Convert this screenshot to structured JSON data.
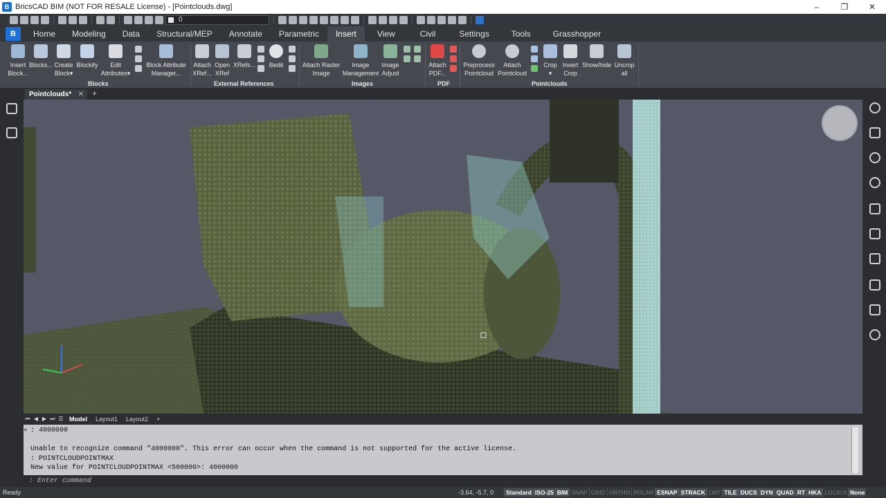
{
  "window": {
    "title": "BricsCAD BIM (NOT FOR RESALE License) - [Pointclouds.dwg]",
    "controls": [
      "–",
      "❐",
      "✕"
    ]
  },
  "qat": {
    "layer_value": "0"
  },
  "ribbon_tabs": [
    "Home",
    "Modeling",
    "Data",
    "Structural/MEP",
    "Annotate",
    "Parametric",
    "Insert",
    "View",
    "Civil",
    "Settings",
    "Tools",
    "Grasshopper"
  ],
  "active_tab": "Insert",
  "ribbon": {
    "blocks": {
      "label": "Blocks",
      "buttons": [
        {
          "l1": "Insert",
          "l2": "Block..."
        },
        {
          "l1": "Blocks...",
          "l2": ""
        },
        {
          "l1": "Create",
          "l2": "Block▾"
        },
        {
          "l1": "Blockify",
          "l2": ""
        },
        {
          "l1": "Edit",
          "l2": "Attributes▾"
        },
        {
          "l1": "Block Attribute",
          "l2": "Manager..."
        }
      ]
    },
    "xref": {
      "label": "External References",
      "buttons": [
        {
          "l1": "Attach",
          "l2": "XRef..."
        },
        {
          "l1": "Open",
          "l2": "XRef"
        },
        {
          "l1": "XRefs...",
          "l2": ""
        },
        {
          "l1": "Bedit",
          "l2": ""
        }
      ]
    },
    "images": {
      "label": "Images",
      "buttons": [
        {
          "l1": "Attach Raster",
          "l2": "Image"
        },
        {
          "l1": "Image",
          "l2": "Management"
        },
        {
          "l1": "Image",
          "l2": "Adjust"
        }
      ]
    },
    "pdf": {
      "label": "PDF",
      "buttons": [
        {
          "l1": "Attach",
          "l2": "PDF..."
        }
      ]
    },
    "pointclouds": {
      "label": "Pointclouds",
      "buttons": [
        {
          "l1": "Preprocess",
          "l2": "Pointcloud"
        },
        {
          "l1": "Attach",
          "l2": "Pointcloud"
        },
        {
          "l1": "Crop",
          "l2": "▾"
        },
        {
          "l1": "Invert",
          "l2": "Crop"
        },
        {
          "l1": "Show/hide",
          "l2": ""
        },
        {
          "l1": "Uncrop",
          "l2": "all"
        }
      ]
    }
  },
  "doc_tab": {
    "label": "Pointclouds*",
    "close": "✕",
    "add": "+"
  },
  "layout_tabs": [
    "Model",
    "Layout1",
    "Layout2",
    "+"
  ],
  "command_history": [
    ": 4000000",
    "",
    "Unable to recognize command \"4000000\". This error can occur when the command is not supported for the active license.",
    ": POINTCLOUDPOINTMAX",
    "New value for POINTCLOUDPOINTMAX <500000>: 4000000"
  ],
  "command_placeholder": ": Enter command",
  "status": {
    "ready": "Ready",
    "coords": "-3.64, -5.7, 0",
    "items": [
      {
        "t": "Standard",
        "s": "on"
      },
      {
        "t": "ISO-25",
        "s": "on"
      },
      {
        "t": "BIM",
        "s": "on"
      },
      {
        "t": "SNAP",
        "s": "off"
      },
      {
        "t": "GRID",
        "s": "off"
      },
      {
        "t": "ORTHO",
        "s": "off"
      },
      {
        "t": "POLAR",
        "s": "off"
      },
      {
        "t": "ESNAP",
        "s": "on"
      },
      {
        "t": "STRACK",
        "s": "on"
      },
      {
        "t": "LWT",
        "s": "off"
      },
      {
        "t": "TILE",
        "s": "on"
      },
      {
        "t": "DUCS",
        "s": "on"
      },
      {
        "t": "DYN",
        "s": "on"
      },
      {
        "t": "QUAD",
        "s": "on"
      },
      {
        "t": "RT",
        "s": "on"
      },
      {
        "t": "HKA",
        "s": "on"
      },
      {
        "t": "LOCKUI",
        "s": "off"
      },
      {
        "t": "None",
        "s": "on"
      }
    ]
  },
  "colors": {
    "accent": "#1f6fd6",
    "viewport_bg": "#545867"
  }
}
